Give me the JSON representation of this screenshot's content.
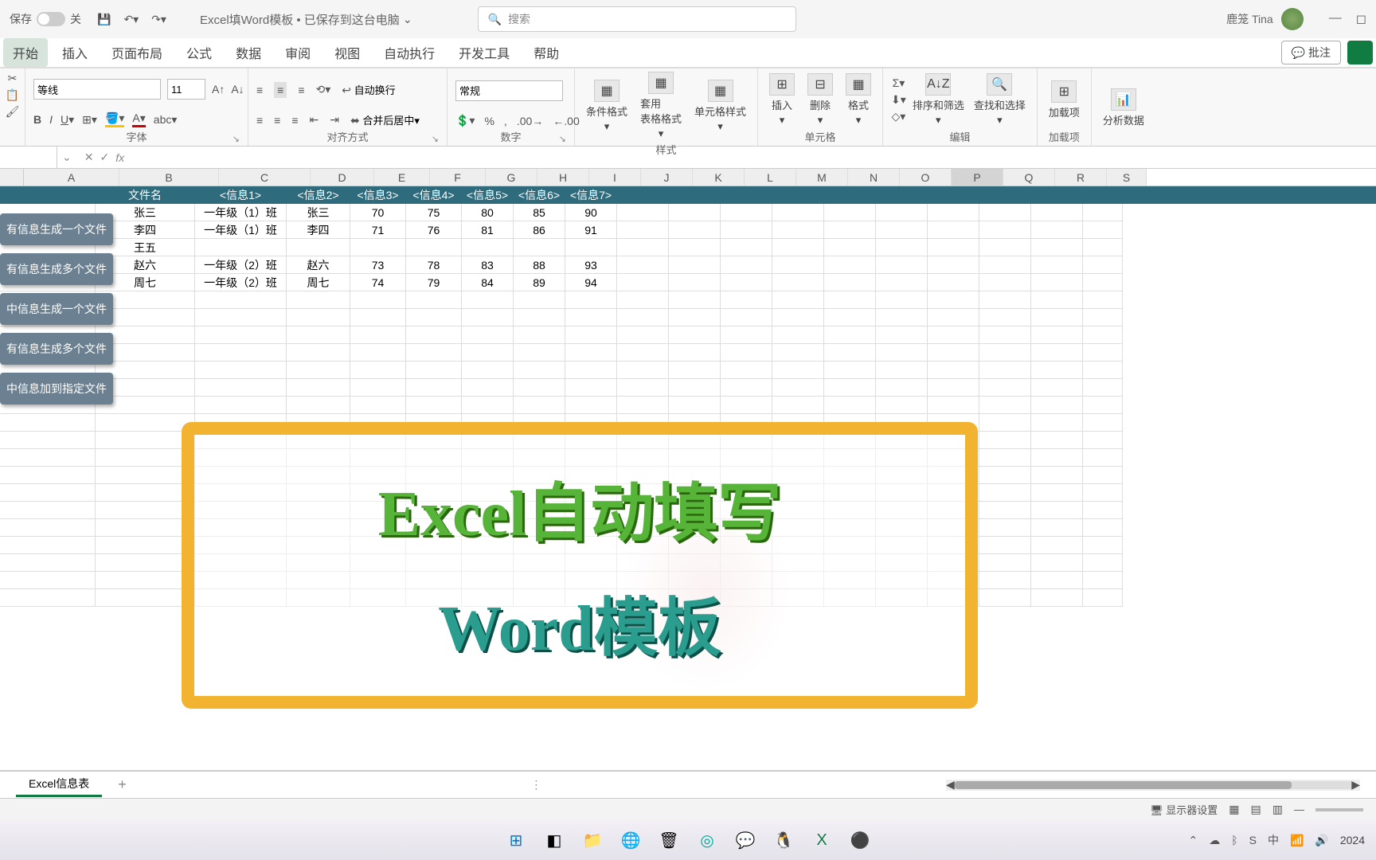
{
  "titlebar": {
    "autosave_label": "保存",
    "autosave_state": "关",
    "doc_title": "Excel填Word模板 • 已保存到这台电脑",
    "search_placeholder": "搜索",
    "user_name": "鹿笼 Tina"
  },
  "tabs": {
    "items": [
      "开始",
      "插入",
      "页面布局",
      "公式",
      "数据",
      "审阅",
      "视图",
      "自动执行",
      "开发工具",
      "帮助"
    ],
    "active_index": 0,
    "comments": "批注"
  },
  "ribbon": {
    "font_name": "等线",
    "font_size": "11",
    "number_format": "常规",
    "wrap_text": "自动换行",
    "merge_center": "合并后居中",
    "cond_fmt": "条件格式",
    "as_table": "套用\n表格格式",
    "cell_styles": "单元格样式",
    "insert": "插入",
    "delete": "删除",
    "format": "格式",
    "sort_filter": "排序和筛选",
    "find_select": "查找和选择",
    "addin": "加载项",
    "analyze": "分析数据",
    "group_font": "字体",
    "group_align": "对齐方式",
    "group_number": "数字",
    "group_styles": "样式",
    "group_cells": "单元格",
    "group_editing": "编辑",
    "group_addins": "加载项"
  },
  "formula": {
    "namebox": "",
    "fx": ""
  },
  "columns": [
    "A",
    "B",
    "C",
    "D",
    "E",
    "F",
    "G",
    "H",
    "I",
    "J",
    "K",
    "L",
    "M",
    "N",
    "O",
    "P",
    "Q",
    "R",
    "S"
  ],
  "header_row": [
    "",
    "文件名",
    "<信息1>",
    "<信息2>",
    "<信息3>",
    "<信息4>",
    "<信息5>",
    "<信息6>",
    "<信息7>",
    "",
    "",
    "",
    "",
    "",
    "",
    "",
    "",
    "",
    ""
  ],
  "rows": [
    [
      "",
      "张三",
      "一年级（1）班",
      "张三",
      "70",
      "75",
      "80",
      "85",
      "90",
      "",
      "",
      "",
      "",
      "",
      "",
      "",
      "",
      "",
      ""
    ],
    [
      "",
      "李四",
      "一年级（1）班",
      "李四",
      "71",
      "76",
      "81",
      "86",
      "91",
      "",
      "",
      "",
      "",
      "",
      "",
      "",
      "",
      "",
      ""
    ],
    [
      "",
      "王五",
      "",
      "",
      "",
      "",
      "",
      "",
      "",
      "",
      "",
      "",
      "",
      "",
      "",
      "",
      "",
      "",
      ""
    ],
    [
      "",
      "赵六",
      "一年级（2）班",
      "赵六",
      "73",
      "78",
      "83",
      "88",
      "93",
      "",
      "",
      "",
      "",
      "",
      "",
      "",
      "",
      "",
      ""
    ],
    [
      "",
      "周七",
      "一年级（2）班",
      "周七",
      "74",
      "79",
      "84",
      "89",
      "94",
      "",
      "",
      "",
      "",
      "",
      "",
      "",
      "",
      "",
      ""
    ]
  ],
  "side_buttons": [
    "有信息生成一个文件",
    "有信息生成多个文件",
    "中信息生成一个文件",
    "有信息生成多个文件",
    "中信息加到指定文件"
  ],
  "overlay": {
    "line1": "Excel自动填写",
    "line2": "Word模板"
  },
  "sheet": {
    "name": "Excel信息表"
  },
  "status": {
    "display_settings": "显示器设置"
  },
  "taskbar": {
    "date": "2024"
  }
}
